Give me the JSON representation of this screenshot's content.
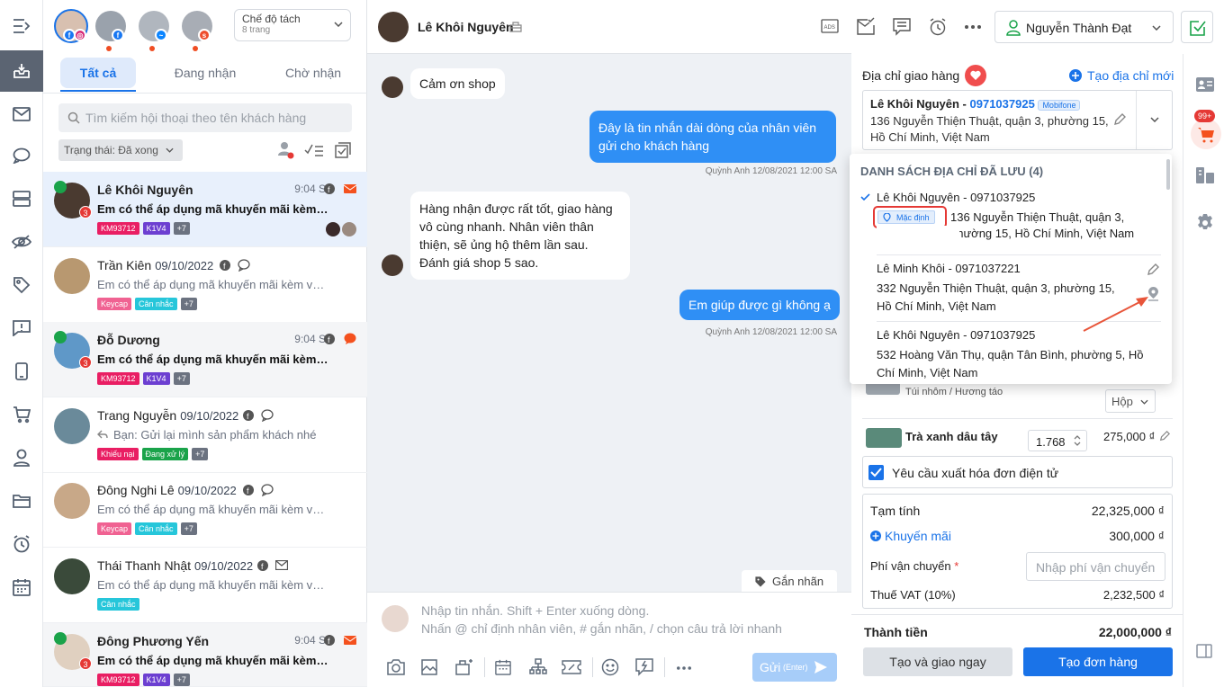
{
  "sidebar": {
    "icons": [
      "collapse-icon",
      "inbox-icon",
      "mail-icon",
      "chat-icon",
      "server-icon",
      "hidden-icon",
      "tag-icon",
      "feedback-icon",
      "mobile-icon",
      "cart-icon",
      "user-icon",
      "folder-icon",
      "alarm-icon",
      "calendar-icon"
    ]
  },
  "pages": {
    "mode_label": "Chế độ tách",
    "mode_sub": "8 trang"
  },
  "tabs": [
    "Tất cả",
    "Đang nhận",
    "Chờ nhận"
  ],
  "search": {
    "placeholder": "Tìm kiếm hội thoại theo tên khách hàng"
  },
  "filter": {
    "status": "Trạng thái: Đã xong"
  },
  "conversations": [
    {
      "name": "Lê Khôi Nguyên",
      "date": "",
      "time": "9:04 SA",
      "msg": "Em có thể áp dụng mã khuyến mãi kèm với...",
      "unread": true,
      "count": "3",
      "tags": [
        "KM93712",
        "K1V4",
        "+7"
      ]
    },
    {
      "name": "Trần Kiên",
      "date": "09/10/2022",
      "time": "",
      "msg": "Em có thể áp dụng mã khuyến mãi kèm với...",
      "unread": false,
      "count": "",
      "tags": [
        "Keycap",
        "Cân nhắc",
        "+7"
      ]
    },
    {
      "name": "Đỗ Dương",
      "date": "",
      "time": "9:04 SA",
      "msg": "Em có thể áp dụng mã khuyến mãi kèm với...",
      "unread": true,
      "count": "3",
      "tags": [
        "KM93712",
        "K1V4",
        "+7"
      ]
    },
    {
      "name": "Trang Nguyễn",
      "date": "09/10/2022",
      "time": "",
      "msg": "Bạn: Gửi lại mình sản phẩm khách nhé",
      "unread": false,
      "count": "",
      "tags": [
        "Khiếu nại",
        "Đang xử lý",
        "+7"
      ]
    },
    {
      "name": "Đông Nghi Lê",
      "date": "09/10/2022",
      "time": "",
      "msg": "Em có thể áp dụng mã khuyến mãi kèm với...",
      "unread": false,
      "count": "",
      "tags": [
        "Keycap",
        "Cân nhắc",
        "+7"
      ]
    },
    {
      "name": "Thái Thanh Nhật",
      "date": "09/10/2022",
      "time": "",
      "msg": "Em có thể áp dụng mã khuyến mãi kèm với...",
      "unread": false,
      "count": "",
      "tags": [
        "Cân nhắc"
      ]
    },
    {
      "name": "Đông Phương Yến",
      "date": "",
      "time": "9:04 SA",
      "msg": "Em có thể áp dụng mã khuyến mãi kèm với...",
      "unread": true,
      "count": "3",
      "tags": [
        "KM93712",
        "K1V4",
        "+7"
      ]
    }
  ],
  "chat": {
    "customer_name": "Lê Khôi Nguyên",
    "assignee": "Nguyễn Thành Đạt",
    "messages": [
      {
        "dir": "in",
        "text": "Cảm ơn shop"
      },
      {
        "dir": "out",
        "text": "Đây là tin nhắn dài dòng của nhân viên gửi cho khách hàng",
        "meta": "Quỳnh Anh 12/08/2021 12:00 SA"
      },
      {
        "dir": "in",
        "text": "Hàng nhận được rất tốt, giao hàng vô cùng nhanh. Nhân viên thân thiện, sẽ ủng hộ thêm lần sau. Đánh giá shop 5 sao."
      },
      {
        "dir": "out",
        "text": "Em giúp được gì không ạ",
        "meta": "Quỳnh Anh 12/08/2021 12:00 SA"
      }
    ],
    "tag_button": "Gắn nhãn",
    "input_line1": "Nhập tin nhắn. Shift + Enter xuống dòng.",
    "input_line2": "Nhấn @ chỉ định nhân viên, # gắn nhãn, / chọn câu trả lời nhanh",
    "send_label": "Gửi",
    "send_hint": "(Enter)"
  },
  "order": {
    "address_title": "Địa chỉ giao hàng",
    "create_address": "Tạo địa chỉ mới",
    "selected": {
      "name": "Lê Khôi Nguyên - ",
      "phone": "0971037925",
      "carrier": "Mobifone",
      "addr": "136 Nguyễn Thiện Thuật, quận 3, phường 15, Hồ Chí Minh, Việt Nam"
    },
    "saved_title": "DANH SÁCH ĐỊA CHỈ ĐÃ LƯU (4)",
    "saved": [
      {
        "head": "Lê Khôi Nguyên - 0971037925",
        "default": "Mặc định",
        "addr": "136 Nguyễn Thiện Thuật, quận 3, phường 15, Hồ Chí Minh, Việt Nam"
      },
      {
        "head": "Lê Minh Khôi - 0971037221",
        "addr": "332 Nguyễn Thiện Thuật, quận 3, phường 15, Hồ Chí Minh, Việt Nam"
      },
      {
        "head": "Lê Khôi Nguyên - 0971037925",
        "addr": "532 Hoàng Văn Thụ, quận Tân Bình, phường 5, Hồ Chí Minh, Việt Nam"
      }
    ],
    "product1_variant": "Túi nhôm / Hương táo",
    "product1_unit": "Hộp",
    "product2_name": "Trà xanh dâu tây",
    "product2_qty": "1.768",
    "product2_price": "275,000 ₫",
    "invoice": "Yêu cầu xuất hóa đơn điện tử",
    "subtotal_label": "Tạm tính",
    "subtotal": "22,325,000 ₫",
    "promo_label": "Khuyến mãi",
    "promo": "300,000 ₫",
    "ship_label": "Phí vận chuyển",
    "ship_placeholder": "Nhập phí vận chuyển",
    "vat_label": "Thuế VAT (10%)",
    "vat": "2,232,500 ₫",
    "total_label": "Thành tiền",
    "total": "22,000,000 ₫",
    "btn_ship_now": "Tạo và giao ngay",
    "btn_create": "Tạo đơn hàng",
    "cart_badge": "99+"
  },
  "colors": {
    "accent": "#1a73e8",
    "send": "#2f8ff5",
    "red": "#e53935"
  }
}
